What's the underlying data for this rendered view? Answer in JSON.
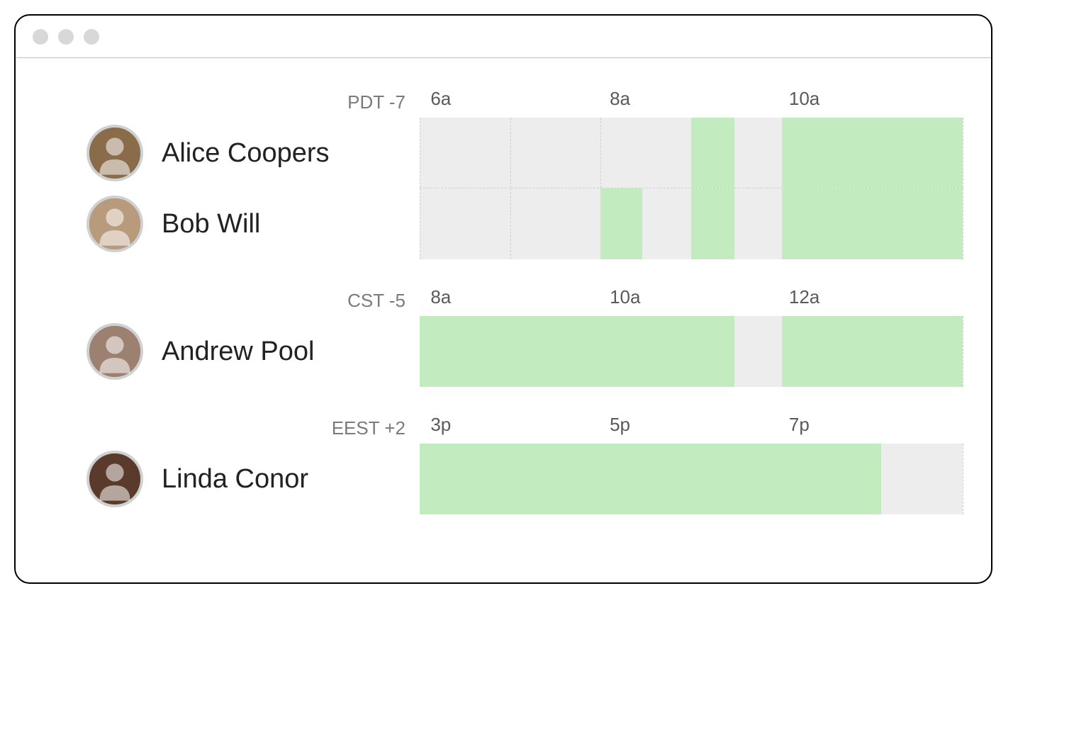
{
  "timeline": {
    "columns": 6,
    "gridlines_percent": [
      0,
      16.67,
      33.33,
      50,
      66.67,
      83.33,
      100
    ]
  },
  "groups": [
    {
      "tz_label": "PDT -7",
      "ticks": [
        {
          "label": "6a",
          "pos_percent": 2
        },
        {
          "label": "8a",
          "pos_percent": 35
        },
        {
          "label": "10a",
          "pos_percent": 68
        }
      ],
      "people": [
        {
          "name": "Alice Coopers",
          "avatar_color": "#8a6b4a",
          "avail": [
            {
              "start": 50,
              "end": 58
            },
            {
              "start": 66.67,
              "end": 100
            }
          ]
        },
        {
          "name": "Bob Will",
          "avatar_color": "#b89a7c",
          "avail": [
            {
              "start": 33.33,
              "end": 41
            },
            {
              "start": 50,
              "end": 58
            },
            {
              "start": 66.67,
              "end": 100
            }
          ]
        }
      ]
    },
    {
      "tz_label": "CST -5",
      "ticks": [
        {
          "label": "8a",
          "pos_percent": 2
        },
        {
          "label": "10a",
          "pos_percent": 35
        },
        {
          "label": "12a",
          "pos_percent": 68
        }
      ],
      "people": [
        {
          "name": "Andrew Pool",
          "avatar_color": "#9c8070",
          "avail": [
            {
              "start": 0,
              "end": 58
            },
            {
              "start": 66.67,
              "end": 100
            }
          ]
        }
      ]
    },
    {
      "tz_label": "EEST +2",
      "ticks": [
        {
          "label": "3p",
          "pos_percent": 2
        },
        {
          "label": "5p",
          "pos_percent": 35
        },
        {
          "label": "7p",
          "pos_percent": 68
        }
      ],
      "people": [
        {
          "name": "Linda Conor",
          "avatar_color": "#5a3a2a",
          "avail": [
            {
              "start": 0,
              "end": 85
            }
          ]
        }
      ]
    }
  ]
}
